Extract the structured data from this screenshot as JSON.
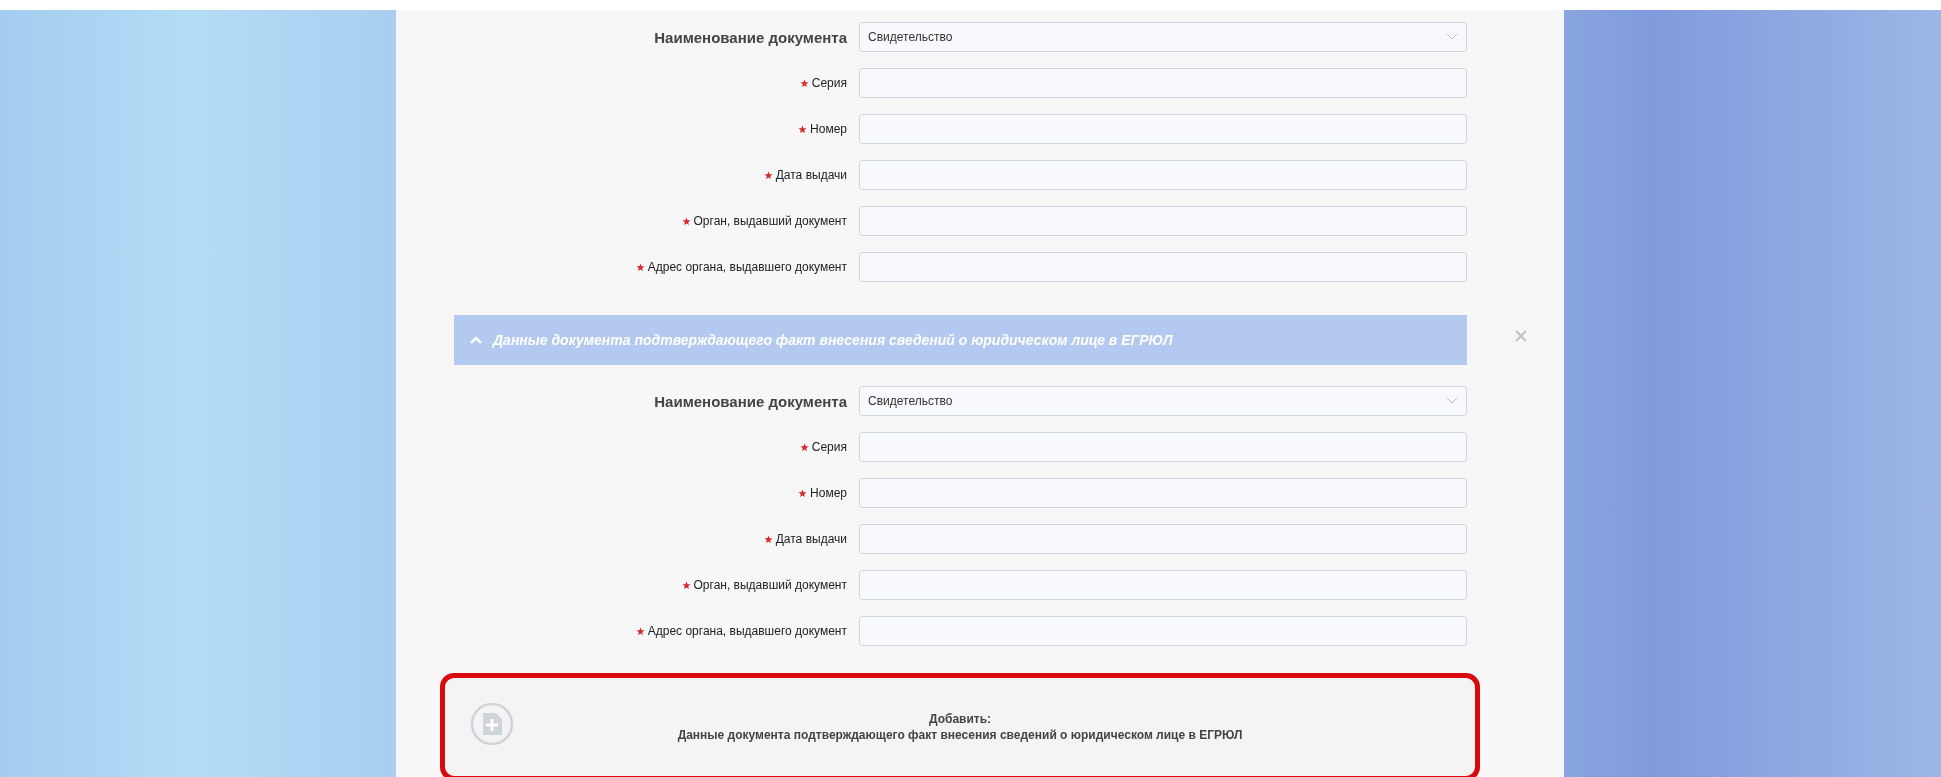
{
  "sections": [
    {
      "fields": [
        {
          "kind": "select",
          "label": "Наименование документа",
          "value": "Свидетельство"
        },
        {
          "kind": "text",
          "label": "Серия",
          "required": true
        },
        {
          "kind": "text",
          "label": "Номер",
          "required": true
        },
        {
          "kind": "text",
          "label": "Дата выдачи",
          "required": true
        },
        {
          "kind": "text",
          "label": "Орган, выдавший документ",
          "required": true
        },
        {
          "kind": "text",
          "label": "Адрес органа, выдавшего документ",
          "required": true
        }
      ]
    },
    {
      "title": "Данные документа подтверждающего факт внесения сведений о юридическом лице в ЕГРЮЛ",
      "expanded": true,
      "fields": [
        {
          "kind": "select",
          "label": "Наименование документа",
          "value": "Свидетельство"
        },
        {
          "kind": "text",
          "label": "Серия",
          "required": true
        },
        {
          "kind": "text",
          "label": "Номер",
          "required": true
        },
        {
          "kind": "text",
          "label": "Дата выдачи",
          "required": true
        },
        {
          "kind": "text",
          "label": "Орган, выдавший документ",
          "required": true
        },
        {
          "kind": "text",
          "label": "Адрес органа, выдавшего документ",
          "required": true
        }
      ]
    }
  ],
  "add_button": {
    "label": "Добавить:",
    "description": "Данные документа подтверждающего факт внесения сведений о юридическом лице в ЕГРЮЛ"
  }
}
